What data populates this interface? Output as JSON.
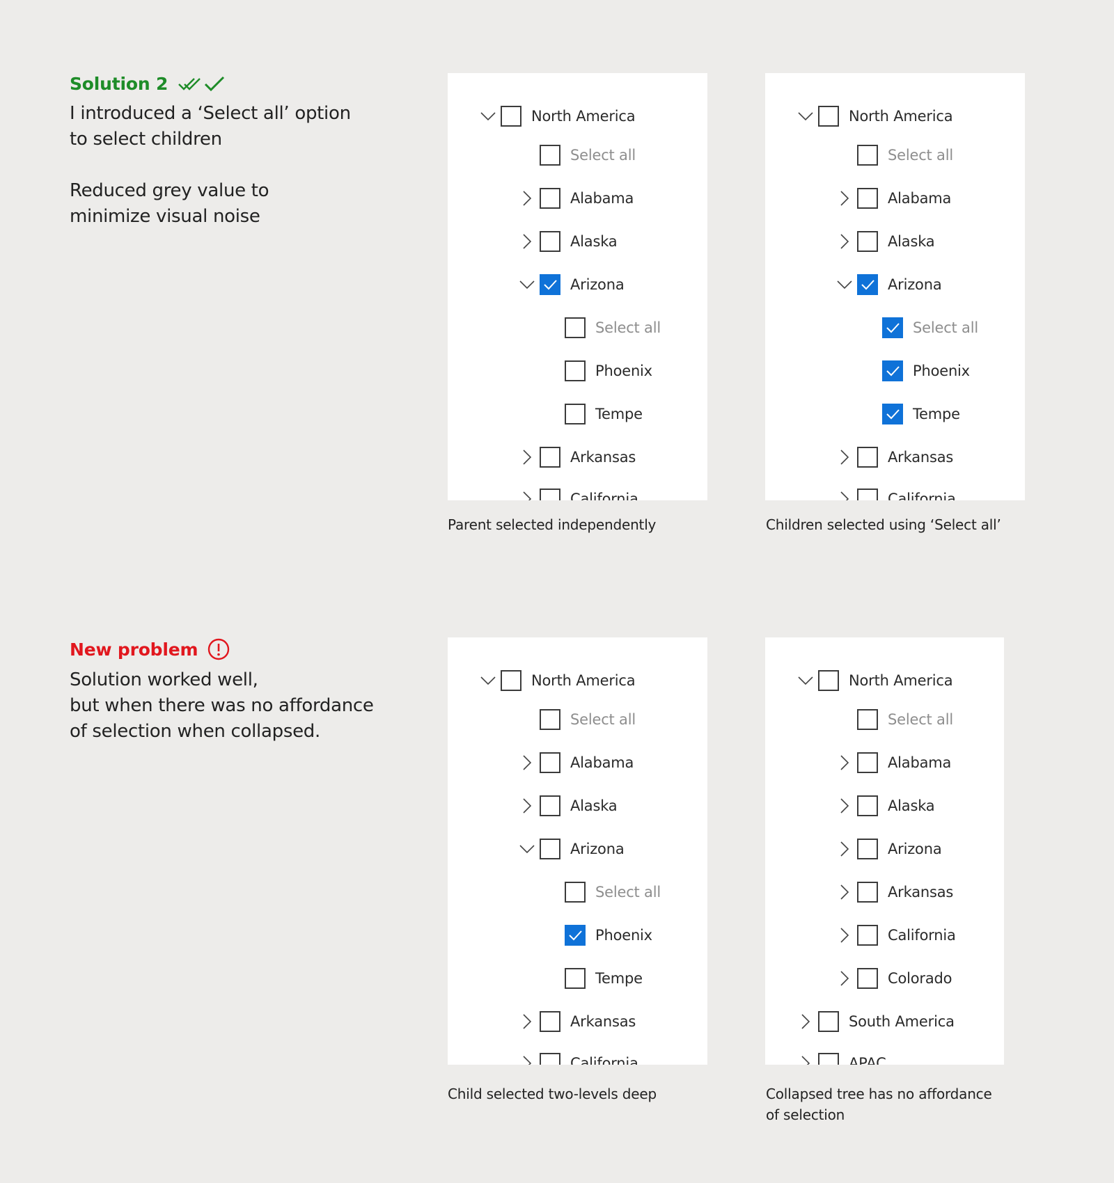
{
  "sections": [
    {
      "heading": "Solution 2",
      "heading_icon": "double-check-icon",
      "heading_color": "#1e8c28",
      "paragraphs": [
        "I introduced a ‘Select all’ option\nto select children",
        "Reduced grey value to\nminimize visual noise"
      ]
    },
    {
      "heading": "New problem",
      "heading_icon": "exclamation-circle-icon",
      "heading_color": "#e1171e",
      "paragraphs": [
        "Solution worked well,\nbut when there was no affordance\nof selection when collapsed."
      ]
    }
  ],
  "accent_color": "#0f72d8",
  "panels": [
    {
      "caption": "Parent selected independently",
      "rows": [
        {
          "label": "North America",
          "level": 0,
          "caret": "down",
          "checked": false
        },
        {
          "label": "Select all",
          "level": 1,
          "caret": "none",
          "checked": false,
          "dim": true
        },
        {
          "label": "Alabama",
          "level": 1,
          "caret": "right",
          "checked": false
        },
        {
          "label": "Alaska",
          "level": 1,
          "caret": "right",
          "checked": false
        },
        {
          "label": "Arizona",
          "level": 1,
          "caret": "down",
          "checked": true
        },
        {
          "label": "Select all",
          "level": 2,
          "caret": "none",
          "checked": false,
          "dim": true
        },
        {
          "label": "Phoenix",
          "level": 2,
          "caret": "none",
          "checked": false
        },
        {
          "label": "Tempe",
          "level": 2,
          "caret": "none",
          "checked": false
        },
        {
          "label": "Arkansas",
          "level": 1,
          "caret": "right",
          "checked": false
        },
        {
          "label": "California",
          "level": 1,
          "caret": "right",
          "checked": false
        }
      ]
    },
    {
      "caption": "Children selected using ‘Select all’",
      "rows": [
        {
          "label": "North America",
          "level": 0,
          "caret": "down",
          "checked": false
        },
        {
          "label": "Select all",
          "level": 1,
          "caret": "none",
          "checked": false,
          "dim": true
        },
        {
          "label": "Alabama",
          "level": 1,
          "caret": "right",
          "checked": false
        },
        {
          "label": "Alaska",
          "level": 1,
          "caret": "right",
          "checked": false
        },
        {
          "label": "Arizona",
          "level": 1,
          "caret": "down",
          "checked": true
        },
        {
          "label": "Select all",
          "level": 2,
          "caret": "none",
          "checked": true,
          "dim": true
        },
        {
          "label": "Phoenix",
          "level": 2,
          "caret": "none",
          "checked": true
        },
        {
          "label": "Tempe",
          "level": 2,
          "caret": "none",
          "checked": true
        },
        {
          "label": "Arkansas",
          "level": 1,
          "caret": "right",
          "checked": false
        },
        {
          "label": "California",
          "level": 1,
          "caret": "right",
          "checked": false
        }
      ]
    },
    {
      "caption": "Child selected two-levels deep",
      "rows": [
        {
          "label": "North America",
          "level": 0,
          "caret": "down",
          "checked": false
        },
        {
          "label": "Select all",
          "level": 1,
          "caret": "none",
          "checked": false,
          "dim": true
        },
        {
          "label": "Alabama",
          "level": 1,
          "caret": "right",
          "checked": false
        },
        {
          "label": "Alaska",
          "level": 1,
          "caret": "right",
          "checked": false
        },
        {
          "label": "Arizona",
          "level": 1,
          "caret": "down",
          "checked": false
        },
        {
          "label": "Select all",
          "level": 2,
          "caret": "none",
          "checked": false,
          "dim": true
        },
        {
          "label": "Phoenix",
          "level": 2,
          "caret": "none",
          "checked": true
        },
        {
          "label": "Tempe",
          "level": 2,
          "caret": "none",
          "checked": false
        },
        {
          "label": "Arkansas",
          "level": 1,
          "caret": "right",
          "checked": false
        },
        {
          "label": "California",
          "level": 1,
          "caret": "right",
          "checked": false
        }
      ]
    },
    {
      "caption": "Collapsed tree has no affordance\nof selection",
      "rows": [
        {
          "label": "North America",
          "level": 0,
          "caret": "down",
          "checked": false
        },
        {
          "label": "Select all",
          "level": 1,
          "caret": "none",
          "checked": false,
          "dim": true
        },
        {
          "label": "Alabama",
          "level": 1,
          "caret": "right",
          "checked": false
        },
        {
          "label": "Alaska",
          "level": 1,
          "caret": "right",
          "checked": false
        },
        {
          "label": "Arizona",
          "level": 1,
          "caret": "right",
          "checked": false
        },
        {
          "label": "Arkansas",
          "level": 1,
          "caret": "right",
          "checked": false
        },
        {
          "label": "California",
          "level": 1,
          "caret": "right",
          "checked": false
        },
        {
          "label": "Colorado",
          "level": 1,
          "caret": "right",
          "checked": false
        },
        {
          "label": "South America",
          "level": 0,
          "caret": "right",
          "checked": false
        },
        {
          "label": "APAC",
          "level": 0,
          "caret": "right",
          "checked": false
        }
      ]
    }
  ]
}
